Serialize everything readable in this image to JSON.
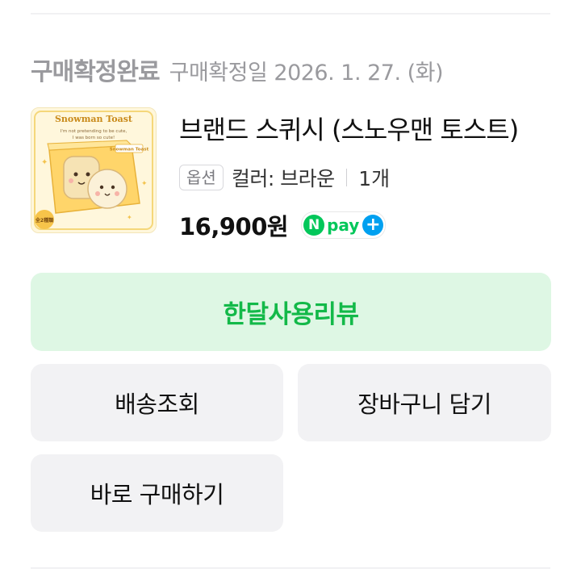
{
  "order": {
    "status": "구매확정완료",
    "confirm_date": "구매확정일 2026. 1. 27. (화)"
  },
  "product": {
    "thumbnail_text": {
      "title": "Snowman Toast",
      "tagline_1": "I'm not pretending to be cute,",
      "tagline_2": "I was born so cute!",
      "box_label": "Snowman Toast",
      "corner_label": "全2種類"
    },
    "name": "브랜드 스퀴시 (스노우맨 토스트)",
    "option_label": "옵션",
    "option_value": "컬러: 브라운",
    "quantity": "1개",
    "price": "16,900원",
    "npay": {
      "n": "N",
      "text": "pay",
      "plus": "+"
    }
  },
  "actions": {
    "review": "한달사용리뷰",
    "delivery": "배송조회",
    "cart": "장바구니 담기",
    "buy_again": "바로 구매하기"
  },
  "colors": {
    "status_gray": "#9a9a9e",
    "review_bg": "#def7e4",
    "review_text": "#13b949",
    "npay_green": "#03c75a",
    "npay_blue": "#00a0f0",
    "button_bg": "#f2f2f4"
  }
}
